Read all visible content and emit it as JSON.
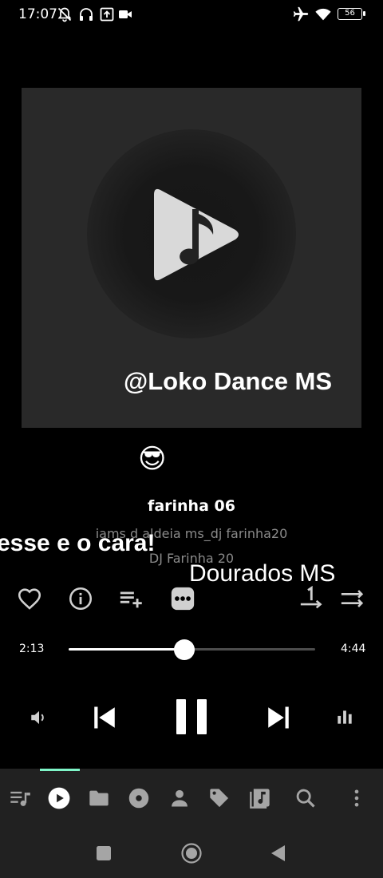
{
  "status_bar": {
    "time": "17:07",
    "battery": "56",
    "left_icons": [
      "muted-bell-icon",
      "headphones-icon",
      "upload-icon",
      "video-camera-icon"
    ],
    "right_icons": [
      "airplane-mode-icon",
      "wifi-icon",
      "battery-icon"
    ]
  },
  "album_art": {
    "icon": "music-note-play-icon",
    "watermark": "@Loko Dance MS"
  },
  "overlay": {
    "emoji": "😎",
    "text_1": "esse e o cara!",
    "text_2": "Dourados MS"
  },
  "track": {
    "title": "farinha 06",
    "album": "iams d aldeia ms_dj farinha20",
    "artist": "DJ Farinha 20"
  },
  "actions": [
    "favorite-icon",
    "info-icon",
    "add-to-playlist-icon",
    "more-options-icon",
    "repeat-one-icon",
    "shuffle-icon"
  ],
  "progress": {
    "current": "2:13",
    "total": "4:44",
    "fraction": 0.469
  },
  "controls": [
    "volume-icon",
    "previous-icon",
    "pause-icon",
    "next-icon",
    "equalizer-icon"
  ],
  "bottom_nav": {
    "items": [
      "queue-icon",
      "now-playing-icon",
      "folder-icon",
      "album-icon",
      "artist-icon",
      "tag-icon",
      "playlist-icon",
      "search-icon",
      "overflow-menu-icon"
    ],
    "active_index": 1,
    "accent_color": "#7ff5c8"
  },
  "system_nav": [
    "recents-icon",
    "home-icon",
    "back-icon"
  ]
}
